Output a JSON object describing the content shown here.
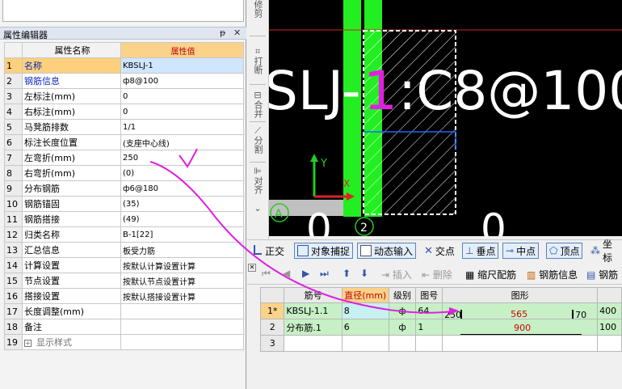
{
  "side_toolbar": {
    "items": [
      "修剪",
      "打断",
      "合并",
      "分割",
      "对齐"
    ]
  },
  "property_panel": {
    "title": "属性编辑器",
    "pin_icon": "pin-icon",
    "close_icon": "close-icon",
    "col_name": "属性名称",
    "col_value": "属性值",
    "rows": [
      {
        "num": "1",
        "name": "名称",
        "value": "KBSLJ-1"
      },
      {
        "num": "2",
        "name": "钢筋信息",
        "value": "ф8@100"
      },
      {
        "num": "3",
        "name": "左标注(mm)",
        "value": "0"
      },
      {
        "num": "4",
        "name": "右标注(mm)",
        "value": "0"
      },
      {
        "num": "5",
        "name": "马凳筋排数",
        "value": "1/1"
      },
      {
        "num": "6",
        "name": "标注长度位置",
        "value": "(支座中心线)"
      },
      {
        "num": "7",
        "name": "左弯折(mm)",
        "value": "250"
      },
      {
        "num": "8",
        "name": "右弯折(mm)",
        "value": "(0)"
      },
      {
        "num": "9",
        "name": "分布钢筋",
        "value": "ф6@180"
      },
      {
        "num": "10",
        "name": "钢筋锚固",
        "value": "(35)"
      },
      {
        "num": "11",
        "name": "钢筋搭接",
        "value": "(49)"
      },
      {
        "num": "12",
        "name": "归类名称",
        "value": "B-1[22]"
      },
      {
        "num": "13",
        "name": "汇总信息",
        "value": "板受力筋"
      },
      {
        "num": "14",
        "name": "计算设置",
        "value": "按默认计算设置计算"
      },
      {
        "num": "15",
        "name": "节点设置",
        "value": "按默认节点设置计算"
      },
      {
        "num": "16",
        "name": "搭接设置",
        "value": "按默认搭接设置计算"
      },
      {
        "num": "17",
        "name": "长度调整(mm)",
        "value": ""
      },
      {
        "num": "18",
        "name": "备注",
        "value": ""
      },
      {
        "num": "19",
        "name": "显示样式",
        "value": ""
      }
    ]
  },
  "canvas": {
    "label_prefix": "SLJ-",
    "label_number": "1",
    "label_suffix": ":C8@100",
    "axis_y": "Y",
    "axis_x": "X",
    "marker_a": "A",
    "marker_2": "2",
    "digit_left": "0",
    "digit_right": "0"
  },
  "snap_toolbar": {
    "items": [
      "正交",
      "对象捕捉",
      "动态输入",
      "交点",
      "垂点",
      "中点",
      "顶点",
      "坐标"
    ]
  },
  "rebar_toolbar": {
    "insert": "插入",
    "delete": "删除",
    "scale": "缩尺配筋",
    "info": "钢筋信息",
    "more": "钢筋"
  },
  "rebar_table": {
    "headers": [
      "筋号",
      "直径(mm)",
      "级别",
      "图号",
      "图形",
      ""
    ],
    "rows": [
      {
        "num": "1*",
        "name": "KBSLJ-1.1",
        "dia": "8",
        "grade": "ф",
        "fig": "64",
        "left": "250",
        "mid": "565",
        "right": "70",
        "extra": "400"
      },
      {
        "num": "2",
        "name": "分布筋.1",
        "dia": "6",
        "grade": "ф",
        "fig": "1",
        "mid": "900",
        "extra": "100"
      },
      {
        "num": "3",
        "name": "",
        "dia": "",
        "grade": "",
        "fig": "",
        "extra": ""
      }
    ]
  },
  "colors": {
    "canvas_bg": "#000000",
    "wall_green": "#22ee22",
    "annotation_magenta": "#e020e0",
    "header_value_bg": "#fbd28a"
  }
}
